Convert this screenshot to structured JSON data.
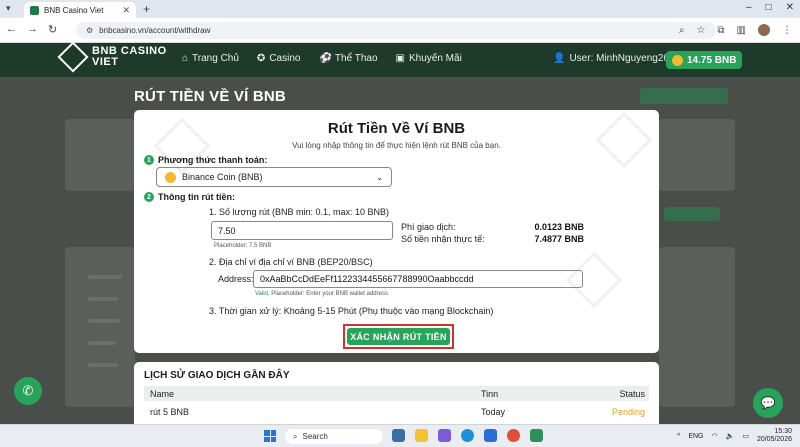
{
  "browser": {
    "tab_title": "BNB Casino Viet",
    "url": "bnbcasino.vn/account/withdraw"
  },
  "site": {
    "logo_line1": "BNB CASINO",
    "logo_line2": "VIET",
    "nav": [
      {
        "label": "Trang Chủ",
        "icon": "home-icon"
      },
      {
        "label": "Casino",
        "icon": "casino-chip-icon"
      },
      {
        "label": "Thể Thao",
        "icon": "soccer-ball-icon"
      },
      {
        "label": "Khuyến Mãi",
        "icon": "gift-icon"
      }
    ],
    "user_label": "User: MinhNguyeng26",
    "balance": "14.75 BNB"
  },
  "page": {
    "title": "RÚT TIỀN VỀ VÍ BNB"
  },
  "modal": {
    "title": "Rút Tiền Về Ví BNB",
    "subtitle": "Vui lòng nhập thông tin để thực hiện lệnh rút BNB của bạn.",
    "step1_label": "Phương thức thanh toán:",
    "step1_num": "1",
    "payment_method": "Binance Coin (BNB)",
    "step2_label": "Thông tin rút tiền:",
    "step2_num": "2",
    "amount_label": "1. Số lượng rút (BNB min: 0.1, max: 10 BNB)",
    "amount_value": "7.50",
    "amount_hint": "Placeholder: 7.5 BNB",
    "fee_label": "Phí giao dịch:",
    "fee_value": "0.0123 BNB",
    "received_label": "Số tiền nhận thực tế:",
    "received_value": "7.4877 BNB",
    "address_section_label": "2. Địa chỉ ví địa chỉ ví BNB (BEP20/BSC)",
    "address_label": "Address:",
    "address_value": "0xAaBbCcDdEeFf1122334455667788990Oaabbccdd",
    "address_hint_valid": "Valid,",
    "address_hint_rest": " Placeholder: Enter your BNB wallet address",
    "processing_time": "3. Thời gian xử lý: Khoảng 5-15 Phút (Phụ thuộc vào mạng Blockchain)",
    "confirm_label": "XÁC NHẬN RÚT TIỀN"
  },
  "history": {
    "title": "LỊCH SỬ GIAO DỊCH GẦN ĐÂY",
    "columns": [
      "Name",
      "Tinn",
      "Status"
    ],
    "rows": [
      {
        "name": "rút 5 BNB",
        "time": "Today",
        "status": "Pending"
      }
    ]
  },
  "taskbar": {
    "search_placeholder": "Search",
    "lang": "ENG",
    "time": "15:30",
    "date": "20/05/2026"
  },
  "colors": {
    "brand_green": "#27a35a",
    "header_dark": "#1d3a2b",
    "highlight_red": "#d3312b",
    "pending": "#e0a21b"
  }
}
